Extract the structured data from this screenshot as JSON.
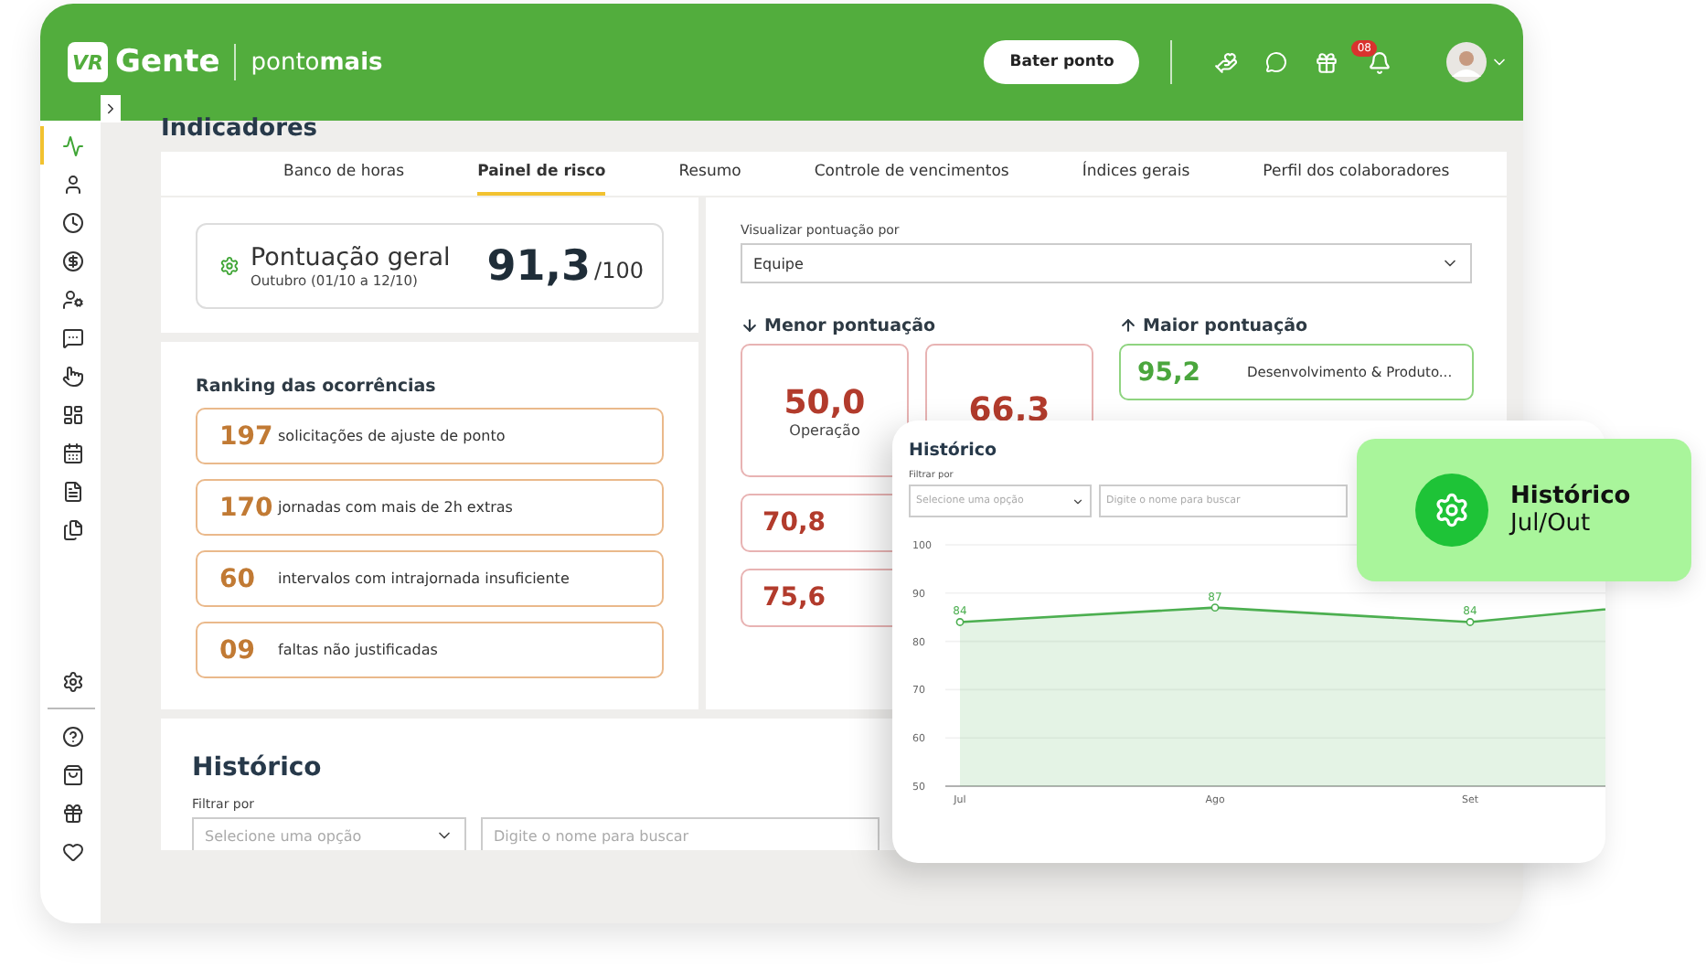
{
  "header": {
    "logo_mark": "VR",
    "logo_text": "Gente",
    "product": "ponto**mais**",
    "clock_button": "Bater ponto",
    "notification_count": "08"
  },
  "sidebar": {
    "items": [
      {
        "selected": true
      },
      {
        "selected": false
      },
      {
        "selected": false
      },
      {
        "selected": false
      },
      {
        "selected": false
      },
      {
        "selected": false
      },
      {
        "selected": false
      },
      {
        "selected": false
      },
      {
        "selected": false
      },
      {
        "selected": false
      },
      {
        "selected": false
      }
    ],
    "footer_items": [
      {
        "selected": false
      },
      {
        "selected": false
      },
      {
        "selected": false
      },
      {
        "selected": false
      },
      {
        "selected": false
      }
    ]
  },
  "page_title": "Indicadores",
  "tabs": [
    {
      "label": "Banco de horas",
      "selected": false
    },
    {
      "label": "Painel de risco",
      "selected": true
    },
    {
      "label": "Resumo",
      "selected": false
    },
    {
      "label": "Controle de vencimentos",
      "selected": false
    },
    {
      "label": "Índices gerais",
      "selected": false
    },
    {
      "label": "Perfil dos colaboradores",
      "selected": false
    }
  ],
  "score": {
    "title": "Pontuação geral",
    "period": "Outubro (01/10 a 12/10)",
    "value": "91,3",
    "max": "/100"
  },
  "ranking": {
    "title": "Ranking das ocorrências",
    "items": [
      {
        "count": "197",
        "description": "solicitações de ajuste de ponto"
      },
      {
        "count": "170",
        "description": "jornadas com mais de 2h extras"
      },
      {
        "count": "60",
        "description": "intervalos com intrajornada insuficiente"
      },
      {
        "count": "09",
        "description": "faltas não justificadas"
      }
    ]
  },
  "team_scores": {
    "view_label": "Visualizar pontuação por",
    "view_value": "Equipe",
    "lowest_title": "Menor pontuação",
    "highest_title": "Maior pontuação",
    "lowest": [
      {
        "kind": "large",
        "score": "50,0",
        "team": "Operação"
      },
      {
        "kind": "large",
        "score": "66,3"
      },
      {
        "kind": "small",
        "score": "70,8"
      },
      {
        "kind": "small",
        "score": "75,6"
      }
    ],
    "highest": [
      {
        "score": "95,2",
        "team": "Desenvolvimento & Produto..."
      }
    ]
  },
  "history_section": {
    "title": "Histórico",
    "filter_label": "Filtrar por",
    "select_placeholder": "Selecione uma opção",
    "search_placeholder": "Digite o nome para buscar"
  },
  "history_popup": {
    "title": "Histórico",
    "filter_label": "Filtrar por",
    "select_placeholder": "Selecione uma opção",
    "search_placeholder": "Digite o nome para buscar",
    "chart_data": {
      "type": "area",
      "categories": [
        "Jul",
        "Ago",
        "Set",
        null
      ],
      "series": [
        {
          "color": "#4caf50",
          "values": [
            84,
            87,
            84,
            89
          ]
        }
      ],
      "ylim": [
        50,
        100
      ],
      "grid": true,
      "yticks": [
        50,
        60,
        70,
        80,
        90,
        100
      ],
      "value_labels": [
        "84",
        "87",
        "84",
        null
      ]
    }
  },
  "highlight_badge": {
    "title": "Histórico",
    "subtitle": "Jul/Out"
  }
}
